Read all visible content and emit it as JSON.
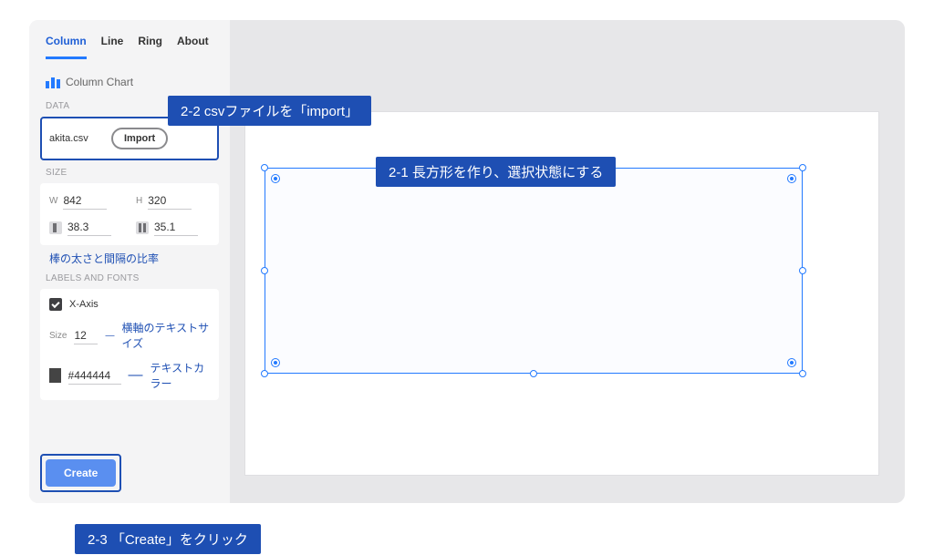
{
  "tabs": {
    "column": "Column",
    "line": "Line",
    "ring": "Ring",
    "about": "About"
  },
  "title": "Column Chart",
  "sections": {
    "data": "DATA",
    "size": "SIZE",
    "labels": "LABELS AND FONTS"
  },
  "data": {
    "filename": "akita.csv",
    "import": "Import"
  },
  "size": {
    "wLabel": "W",
    "w": "842",
    "hLabel": "H",
    "h": "320",
    "barW": "38.3",
    "gapW": "35.1"
  },
  "notes": {
    "ratio": "棒の太さと間隔の比率",
    "xsize": "横軸のテキストサイズ",
    "tcolor": "テキストカラー"
  },
  "labels": {
    "xaxis": "X-Axis",
    "sizeLabel": "Size",
    "size": "12",
    "hex": "#444444"
  },
  "create": "Create",
  "callouts": {
    "csv": "2-2 csvファイルを「import」",
    "rect": "2-1 長方形を作り、選択状態にする",
    "create": "2-3 「Create」をクリック"
  },
  "dash": "—"
}
